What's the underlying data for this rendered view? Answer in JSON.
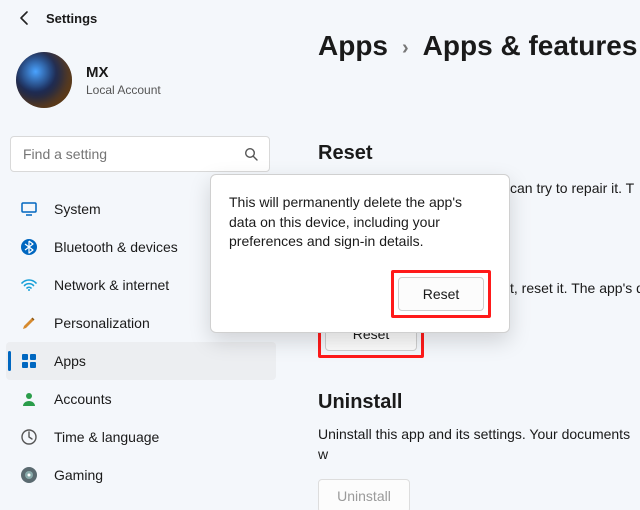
{
  "header": {
    "title": "Settings"
  },
  "profile": {
    "name": "MX",
    "sub": "Local Account"
  },
  "search": {
    "placeholder": "Find a setting"
  },
  "nav": {
    "items": [
      {
        "label": "System"
      },
      {
        "label": "Bluetooth & devices"
      },
      {
        "label": "Network & internet"
      },
      {
        "label": "Personalization"
      },
      {
        "label": "Apps"
      },
      {
        "label": "Accounts"
      },
      {
        "label": "Time & language"
      },
      {
        "label": "Gaming"
      }
    ]
  },
  "crumb": {
    "a": "Apps",
    "b": "Apps & features"
  },
  "reset": {
    "heading": "Reset",
    "repair_peek": "can try to repair it. T",
    "popup_text": "This will permanently delete the app's data on this device, including your preferences and sign-in details.",
    "popup_button": "Reset",
    "desc_peek": "t, reset it. The app's d",
    "button": "Reset"
  },
  "uninstall": {
    "heading": "Uninstall",
    "desc": "Uninstall this app and its settings. Your documents w",
    "button": "Uninstall"
  }
}
